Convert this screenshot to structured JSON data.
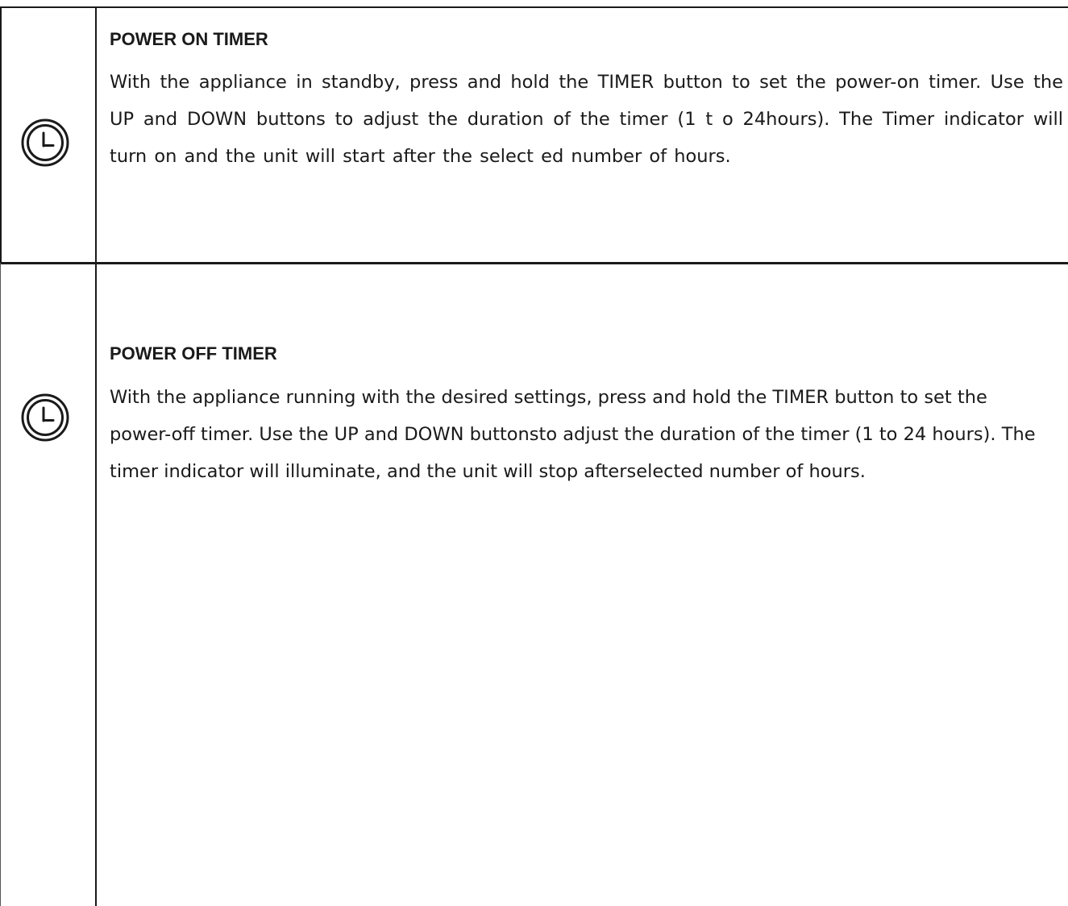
{
  "sections": [
    {
      "icon": "clock-icon",
      "heading": "POWER ON TIMER",
      "body": "With the appliance in standby, press and hold the TIMER button to set the power-on timer. Use the UP and DOWN buttons to adjust the duration of the timer (1 t o 24hours). The Timer indicator will turn on and the unit will start after the select ed number of hours."
    },
    {
      "icon": "clock-icon",
      "heading": "POWER OFF TIMER",
      "body": "With the appliance running with the desired settings, press and hold the TIMER button to set the power-off timer. Use the UP and DOWN buttonsto adjust the duration of the timer (1 to 24 hours). The timer indicator will illuminate, and the unit will stop afterselected number of hours."
    }
  ]
}
